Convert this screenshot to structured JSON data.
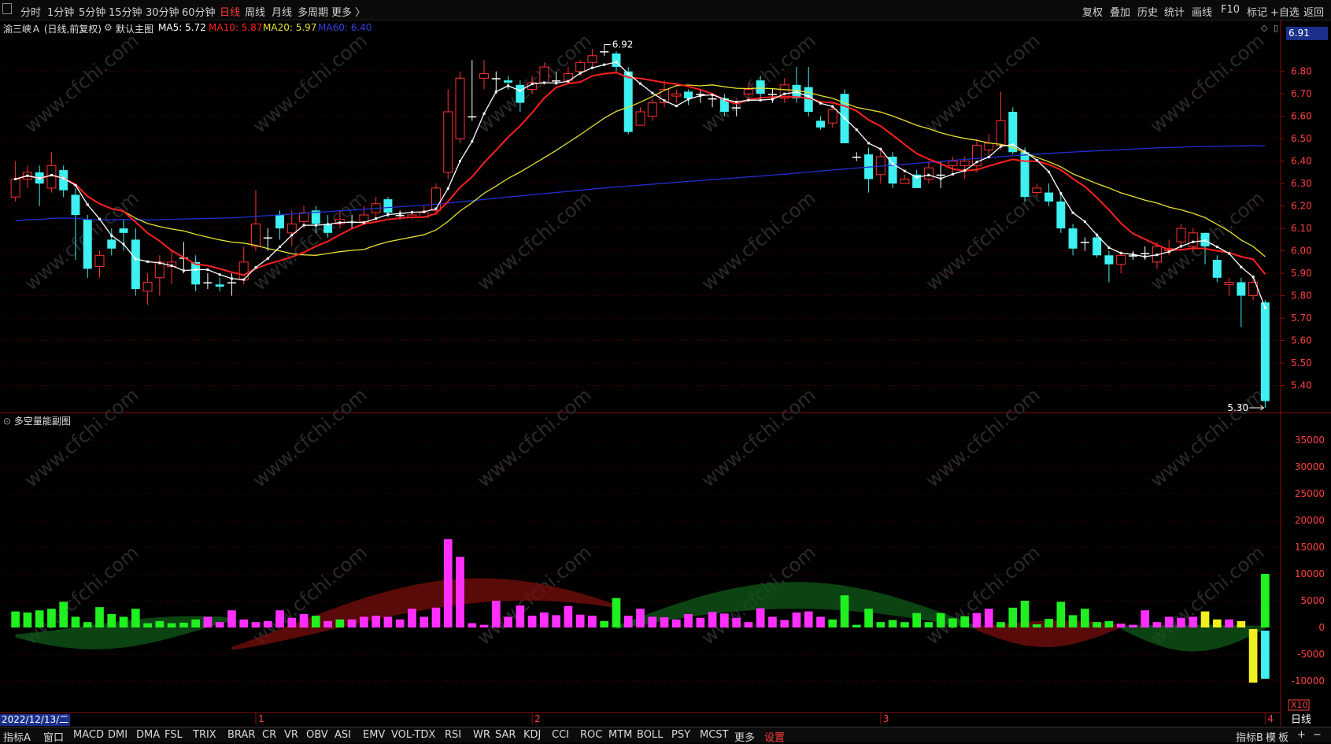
{
  "toolbar": {
    "left_items": [
      "分时",
      "1分钟",
      "5分钟",
      "15分钟",
      "30分钟",
      "60分钟",
      "日线",
      "周线",
      "月线",
      "多周期",
      "更多 〉"
    ],
    "active_item": "日线",
    "right_items": [
      "复权",
      "叠加",
      "历史",
      "统计",
      "画线",
      "F10",
      "标记",
      "+自选",
      "返回"
    ]
  },
  "info": {
    "stock": "渝三峡Ａ (日线,前复权)",
    "main_chart_label": "默认主图",
    "ma5": "MA5: 5.72",
    "ma10": "MA10: 5.87",
    "ma20": "MA20: 5.97",
    "ma60": "MA60: 6.40",
    "current_price": "6.91"
  },
  "colors": {
    "up": "#ff3232",
    "down": "#3ef0f0",
    "ma5": "#ffffff",
    "ma10": "#ff2020",
    "ma20": "#e8e030",
    "ma60": "#2030d0",
    "grid": "#5a0000",
    "vol_pos": "#ff30ff",
    "vol_neg": "#20f020",
    "vol_yellow": "#f0f020"
  },
  "price_axis": {
    "ticks": [
      "6.80",
      "6.70",
      "6.60",
      "6.50",
      "6.40",
      "6.30",
      "6.20",
      "6.10",
      "6.00",
      "5.90",
      "5.80",
      "5.70",
      "5.60",
      "5.50",
      "5.40"
    ],
    "ymin": 5.3,
    "ymax": 6.95
  },
  "annotations": {
    "high": "6.92",
    "low": "5.30"
  },
  "sub_chart": {
    "title": "多空量能副图",
    "ticks": [
      "35000",
      "30000",
      "25000",
      "20000",
      "15000",
      "10000",
      "5000",
      "0",
      "-5000",
      "-10000"
    ],
    "multiplier": "X10"
  },
  "time_axis": {
    "date": "2022/12/13/二",
    "month_labels": [
      "1",
      "2",
      "3",
      "4"
    ],
    "period_label": "日线"
  },
  "chart_data": {
    "type": "candlestick",
    "candles": [
      [
        6.24,
        6.32,
        6.4,
        6.22
      ],
      [
        6.32,
        6.35,
        6.38,
        6.28
      ],
      [
        6.35,
        6.3,
        6.38,
        6.2
      ],
      [
        6.28,
        6.38,
        6.44,
        6.26
      ],
      [
        6.36,
        6.27,
        6.38,
        6.24
      ],
      [
        6.25,
        6.16,
        6.28,
        5.96
      ],
      [
        6.14,
        5.92,
        6.16,
        5.88
      ],
      [
        5.93,
        5.98,
        6.0,
        5.88
      ],
      [
        6.05,
        6.01,
        6.1,
        5.98
      ],
      [
        6.1,
        6.08,
        6.14,
        6.0
      ],
      [
        6.05,
        5.83,
        6.1,
        5.8
      ],
      [
        5.82,
        5.86,
        5.9,
        5.76
      ],
      [
        5.88,
        5.95,
        5.98,
        5.8
      ],
      [
        5.93,
        5.95,
        6.0,
        5.85
      ],
      [
        5.97,
        5.97,
        6.04,
        5.9
      ],
      [
        5.95,
        5.85,
        5.98,
        5.82
      ],
      [
        5.86,
        5.86,
        5.9,
        5.83
      ],
      [
        5.85,
        5.84,
        5.88,
        5.82
      ],
      [
        5.86,
        5.86,
        5.9,
        5.8
      ],
      [
        5.87,
        5.95,
        6.02,
        5.85
      ],
      [
        6.02,
        6.12,
        6.27,
        6.0
      ],
      [
        6.06,
        6.06,
        6.1,
        6.0
      ],
      [
        6.16,
        6.1,
        6.18,
        6.05
      ],
      [
        6.08,
        6.12,
        6.18,
        6.02
      ],
      [
        6.13,
        6.17,
        6.2,
        6.1
      ],
      [
        6.18,
        6.12,
        6.2,
        6.08
      ],
      [
        6.12,
        6.08,
        6.16,
        6.06
      ],
      [
        6.12,
        6.14,
        6.18,
        6.1
      ],
      [
        6.13,
        6.13,
        6.16,
        6.1
      ],
      [
        6.13,
        6.16,
        6.2,
        6.12
      ],
      [
        6.17,
        6.21,
        6.24,
        6.15
      ],
      [
        6.23,
        6.17,
        6.24,
        6.15
      ],
      [
        6.16,
        6.16,
        6.18,
        6.14
      ],
      [
        6.15,
        6.16,
        6.18,
        6.14
      ],
      [
        6.15,
        6.17,
        6.2,
        6.15
      ],
      [
        6.18,
        6.28,
        6.3,
        6.16
      ],
      [
        6.35,
        6.62,
        6.72,
        6.32
      ],
      [
        6.5,
        6.77,
        6.8,
        6.48
      ],
      [
        6.6,
        6.6,
        6.85,
        6.58
      ],
      [
        6.77,
        6.79,
        6.85,
        6.72
      ],
      [
        6.77,
        6.77,
        6.8,
        6.7
      ],
      [
        6.76,
        6.75,
        6.78,
        6.72
      ],
      [
        6.74,
        6.66,
        6.76,
        6.62
      ],
      [
        6.72,
        6.75,
        6.78,
        6.7
      ],
      [
        6.75,
        6.82,
        6.84,
        6.74
      ],
      [
        6.76,
        6.76,
        6.8,
        6.74
      ],
      [
        6.76,
        6.79,
        6.82,
        6.75
      ],
      [
        6.8,
        6.84,
        6.85,
        6.78
      ],
      [
        6.84,
        6.87,
        6.9,
        6.82
      ],
      [
        6.89,
        6.89,
        6.92,
        6.87
      ],
      [
        6.88,
        6.82,
        6.89,
        6.8
      ],
      [
        6.8,
        6.53,
        6.82,
        6.52
      ],
      [
        6.56,
        6.62,
        6.64,
        6.56
      ],
      [
        6.6,
        6.66,
        6.68,
        6.58
      ],
      [
        6.66,
        6.72,
        6.76,
        6.64
      ],
      [
        6.69,
        6.7,
        6.72,
        6.66
      ],
      [
        6.71,
        6.68,
        6.72,
        6.65
      ],
      [
        6.7,
        6.7,
        6.72,
        6.66
      ],
      [
        6.68,
        6.68,
        6.7,
        6.64
      ],
      [
        6.68,
        6.62,
        6.7,
        6.6
      ],
      [
        6.64,
        6.64,
        6.66,
        6.6
      ],
      [
        6.7,
        6.72,
        6.75,
        6.68
      ],
      [
        6.76,
        6.7,
        6.78,
        6.68
      ],
      [
        6.7,
        6.7,
        6.72,
        6.66
      ],
      [
        6.68,
        6.74,
        6.77,
        6.66
      ],
      [
        6.74,
        6.68,
        6.82,
        6.66
      ],
      [
        6.73,
        6.62,
        6.82,
        6.6
      ],
      [
        6.58,
        6.55,
        6.6,
        6.54
      ],
      [
        6.57,
        6.63,
        6.65,
        6.55
      ],
      [
        6.7,
        6.48,
        6.72,
        6.48
      ],
      [
        6.42,
        6.42,
        6.44,
        6.4
      ],
      [
        6.43,
        6.32,
        6.46,
        6.26
      ],
      [
        6.34,
        6.42,
        6.46,
        6.3
      ],
      [
        6.42,
        6.3,
        6.44,
        6.28
      ],
      [
        6.3,
        6.32,
        6.34,
        6.3
      ],
      [
        6.34,
        6.28,
        6.36,
        6.28
      ],
      [
        6.32,
        6.37,
        6.4,
        6.3
      ],
      [
        6.34,
        6.34,
        6.4,
        6.28
      ],
      [
        6.38,
        6.4,
        6.42,
        6.35
      ],
      [
        6.38,
        6.4,
        6.42,
        6.32
      ],
      [
        6.38,
        6.47,
        6.5,
        6.35
      ],
      [
        6.45,
        6.48,
        6.52,
        6.42
      ],
      [
        6.47,
        6.58,
        6.71,
        6.45
      ],
      [
        6.62,
        6.44,
        6.64,
        6.43
      ],
      [
        6.44,
        6.24,
        6.46,
        6.22
      ],
      [
        6.26,
        6.28,
        6.3,
        6.24
      ],
      [
        6.26,
        6.22,
        6.3,
        6.2
      ],
      [
        6.22,
        6.1,
        6.26,
        6.08
      ],
      [
        6.1,
        6.01,
        6.12,
        5.98
      ],
      [
        6.04,
        6.04,
        6.06,
        6.0
      ],
      [
        6.06,
        5.98,
        6.08,
        5.97
      ],
      [
        5.98,
        5.94,
        6.0,
        5.86
      ],
      [
        5.94,
        5.98,
        6.0,
        5.9
      ],
      [
        5.98,
        5.98,
        6.0,
        5.96
      ],
      [
        5.99,
        5.99,
        6.02,
        5.96
      ],
      [
        5.95,
        6.02,
        6.04,
        5.92
      ],
      [
        6.0,
        6.01,
        6.05,
        5.98
      ],
      [
        6.04,
        6.1,
        6.12,
        6.02
      ],
      [
        6.02,
        6.08,
        6.1,
        6.0
      ],
      [
        6.08,
        6.02,
        6.08,
        5.94
      ],
      [
        5.96,
        5.88,
        5.98,
        5.86
      ],
      [
        5.85,
        5.86,
        5.88,
        5.8
      ],
      [
        5.86,
        5.8,
        5.88,
        5.66
      ],
      [
        5.8,
        5.86,
        5.88,
        5.78
      ],
      [
        5.77,
        5.33,
        5.78,
        5.3
      ]
    ],
    "volume": [
      -3000,
      -2800,
      -3200,
      -3500,
      -4800,
      -2000,
      -1000,
      -3800,
      -2500,
      -2000,
      -3500,
      -800,
      -1200,
      -800,
      -900,
      -1500,
      2000,
      1000,
      3200,
      1500,
      1000,
      1200,
      3200,
      1800,
      2500,
      -2200,
      1200,
      -1500,
      1500,
      2000,
      2200,
      2000,
      1500,
      3500,
      2000,
      3700,
      16500,
      13200,
      800,
      500,
      5000,
      2000,
      4100,
      2200,
      2800,
      2300,
      4000,
      2400,
      2200,
      -1200,
      -5500,
      2200,
      3500,
      2000,
      1900,
      1500,
      2500,
      1800,
      2900,
      2600,
      1800,
      1000,
      3600,
      2000,
      1400,
      2800,
      3000,
      2000,
      -1500,
      -6000,
      -500,
      -3500,
      -1000,
      -1400,
      -1000,
      -2700,
      -1000,
      -2700,
      -1700,
      -2100,
      2700,
      3500,
      -1000,
      -3700,
      -5000,
      -600,
      -1600,
      -4800,
      -2300,
      -3500,
      -1000,
      -1200,
      700,
      500,
      3200,
      1000,
      2000,
      1800,
      2000,
      -3000,
      -1500,
      1500,
      1200,
      -10000,
      -9000
    ]
  }
}
